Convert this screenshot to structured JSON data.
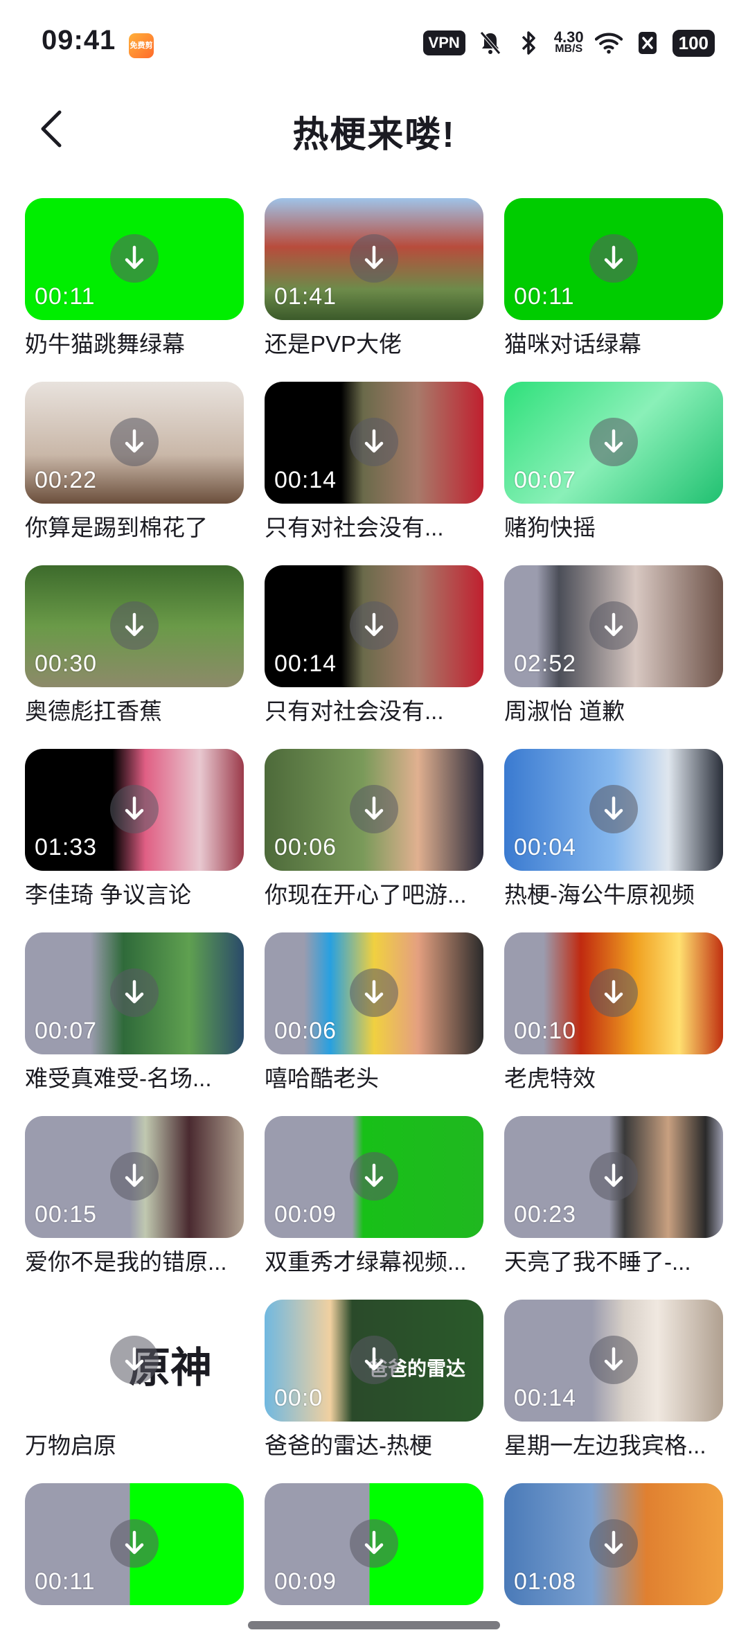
{
  "status_bar": {
    "time": "09:41",
    "app_badge": "免费剪辑",
    "vpn": "VPN",
    "speed_value": "4.30",
    "speed_unit": "MB/S",
    "battery": "100",
    "icons": [
      "mute-icon",
      "bluetooth-icon",
      "wifi-icon",
      "sim-off-icon"
    ]
  },
  "header": {
    "title": "热梗来喽!"
  },
  "colors": {
    "placeholder": "#9b9cae",
    "green_screen": "#00ff00",
    "text": "#1b1b22"
  },
  "items": [
    {
      "title": "奶牛猫跳舞绿幕",
      "duration": "00:11",
      "bg": "#00ee00"
    },
    {
      "title": "还是PVP大佬",
      "duration": "01:41",
      "bg": "linear-gradient(180deg,#9fc3e8 0%,#b84c3c 40%,#6d8b4a 75%,#3b5a2a 100%)"
    },
    {
      "title": "猫咪对话绿幕",
      "duration": "00:11",
      "bg": "#00cc00"
    },
    {
      "title": "你算是踢到棉花了",
      "duration": "00:22",
      "bg": "linear-gradient(180deg,#e8e2dd 0%,#c9b7a8 60%,#6b4f3c 100%)"
    },
    {
      "title": "只有对社会没有...",
      "duration": "00:14",
      "bg": "linear-gradient(90deg,#000 0%,#000 35%,#6a6a4a 45%,#a87a6a 70%,#c0202f 100%)"
    },
    {
      "title": "赌狗快摇",
      "duration": "00:07",
      "bg": "linear-gradient(135deg,#2ee07a 0%,#8af0b8 50%,#20c070 100%)"
    },
    {
      "title": "奥德彪扛香蕉",
      "duration": "00:30",
      "bg": "linear-gradient(180deg,#3d6b2c 0%,#6a9a48 50%,#8d8a6a 100%)"
    },
    {
      "title": "只有对社会没有...",
      "duration": "00:14",
      "bg": "linear-gradient(90deg,#000 0%,#000 35%,#6a6a4a 45%,#a87a6a 70%,#c0202f 100%)"
    },
    {
      "title": "周淑怡 道歉",
      "duration": "02:52",
      "bg": "linear-gradient(90deg,#9b9cae 0%,#9b9cae 15%,#4b4e58 25%,#d8c8c2 60%,#6d5248 100%)"
    },
    {
      "title": "李佳琦 争议言论",
      "duration": "01:33",
      "bg": "linear-gradient(90deg,#000 0%,#000 40%,#e05f84 55%,#e8c8d0 80%,#9b3a4a 100%)"
    },
    {
      "title": "你现在开心了吧游...",
      "duration": "00:06",
      "bg": "linear-gradient(90deg,#4d6a3a 0%,#7a9a5a 45%,#e0b090 70%,#2a2a3a 100%)"
    },
    {
      "title": "热梗-海公牛原视频",
      "duration": "00:04",
      "bg": "linear-gradient(90deg,#3a7ad0 0%,#86b8ee 50%,#dfe6ee 75%,#2a2f3a 100%)"
    },
    {
      "title": "难受真难受-名场...",
      "duration": "00:07",
      "bg": "linear-gradient(90deg,#9b9cae 0%,#9b9cae 30%,#2f6a3a 45%,#5fa050 75%,#2a4a6a 100%)"
    },
    {
      "title": "嘻哈酷老头",
      "duration": "00:06",
      "bg": "linear-gradient(90deg,#9b9cae 0%,#9b9cae 18%,#28a0e0 30%,#f0d040 50%,#e4a080 70%,#2a2a2a 100%)"
    },
    {
      "title": "老虎特效",
      "duration": "00:10",
      "bg": "linear-gradient(90deg,#9b9cae 0%,#9b9cae 18%,#c02a10 35%,#f0a020 60%,#ffe070 80%,#c03010 100%)"
    },
    {
      "title": "爱你不是我的错原...",
      "duration": "00:15",
      "bg": "linear-gradient(90deg,#9b9cae 0%,#9b9cae 48%,#c0c8b0 55%,#4a2a30 75%,#b0a090 100%)"
    },
    {
      "title": "双重秀才绿幕视频...",
      "duration": "00:09",
      "bg": "linear-gradient(90deg,#9b9cae 0%,#9b9cae 40%,#18c018 45%,#20b820 100%)"
    },
    {
      "title": "天亮了我不睡了-...",
      "duration": "00:23",
      "bg": "linear-gradient(90deg,#9b9cae 0%,#9b9cae 48%,#3a3a3a 55%,#c8a080 75%,#2a2a2a 92%,#9b9cae 100%)"
    },
    {
      "title": "万物启原",
      "duration": "",
      "bg": "#ffffff",
      "logo": "原神"
    },
    {
      "title": "爸爸的雷达-热梗",
      "duration": "00:0",
      "bg": "linear-gradient(90deg,#70b8e0 0%,#f0d0a0 30%,#2a4a2a 40%,#2a5a2a 100%)",
      "overlay": "爸爸的雷达"
    },
    {
      "title": "星期一左边我宾格...",
      "duration": "00:14",
      "bg": "linear-gradient(90deg,#9b9cae 0%,#9b9cae 40%,#d8d0c8 55%,#f0e8e0 70%,#b0a090 100%)"
    },
    {
      "title": "",
      "duration": "00:11",
      "bg": "linear-gradient(90deg,#9b9cae 0%,#9b9cae 48%,#00ff00 48%,#00ff00 100%)"
    },
    {
      "title": "",
      "duration": "00:09",
      "bg": "linear-gradient(90deg,#9b9cae 0%,#9b9cae 48%,#00ff00 48%,#00ff00 100%)"
    },
    {
      "title": "",
      "duration": "01:08",
      "bg": "linear-gradient(90deg,#4a7ab8 0%,#7aa0d0 40%,#e08030 65%,#f0a040 100%)"
    }
  ]
}
